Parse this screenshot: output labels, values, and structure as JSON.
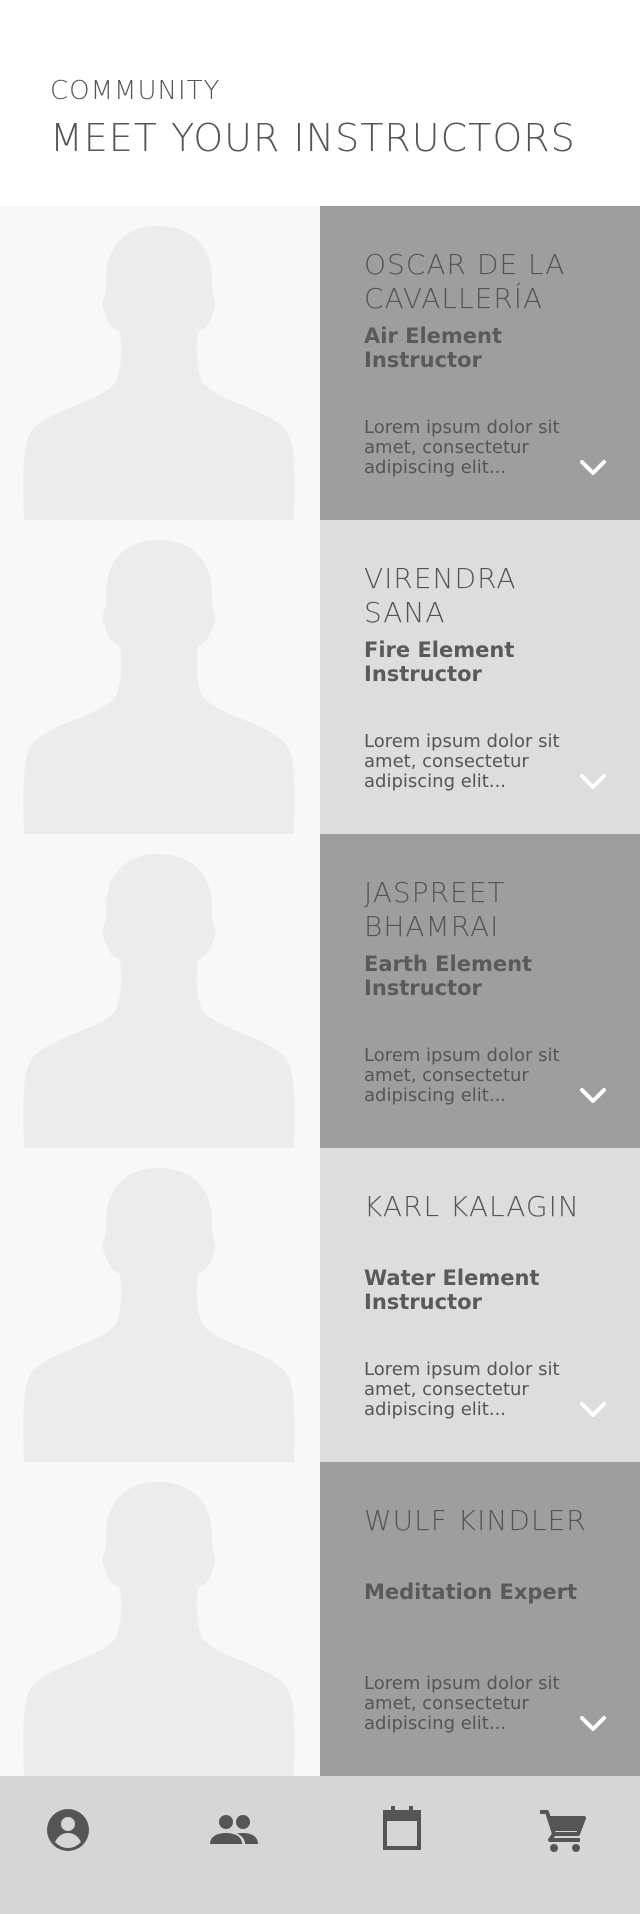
{
  "header": {
    "eyebrow": "COMMUNITY",
    "title": "MEET YOUR INSTRUCTORS"
  },
  "instructors": [
    {
      "name": "OSCAR DE LA CAVALLERÍA",
      "role": "Air Element Instructor",
      "bio": "Lorem ipsum dolor sit amet, consectetur adipiscing elit..."
    },
    {
      "name": "VIRENDRA SANA",
      "role": "Fire Element Instructor",
      "bio": "Lorem ipsum dolor sit amet, consectetur adipiscing elit..."
    },
    {
      "name": "JASPREET BHAMRAI",
      "role": "Earth Element Instructor",
      "bio": "Lorem ipsum dolor sit amet, consectetur adipiscing elit..."
    },
    {
      "name": "KARL KALAGIN",
      "role": "Water Element Instructor",
      "bio": "Lorem ipsum dolor sit amet, consectetur adipiscing elit..."
    },
    {
      "name": "WULF KINDLER",
      "role": "Meditation Expert",
      "bio": "Lorem ipsum dolor sit amet, consectetur adipiscing elit..."
    }
  ],
  "nav": {
    "items": [
      {
        "icon": "account-icon"
      },
      {
        "icon": "people-icon"
      },
      {
        "icon": "calendar-icon"
      },
      {
        "icon": "cart-icon"
      }
    ]
  },
  "colors": {
    "panel_dark": "#9e9e9e",
    "panel_light": "#dddddd",
    "photo_bg": "#f8f8f8",
    "silhouette": "#ececec",
    "nav_bg": "#d6d6d6",
    "text": "#555555"
  }
}
